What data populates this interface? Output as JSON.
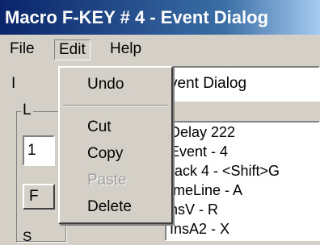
{
  "window": {
    "title": "Macro F-KEY # 4 - Event Dialog"
  },
  "menubar": {
    "file": "File",
    "edit": "Edit",
    "help": "Help"
  },
  "background": {
    "label_partial": "I",
    "name_field_value": "vent Dialog",
    "group_caption": "L",
    "small_field_value": "1",
    "small_button_label": "F",
    "bottom_partial": "S"
  },
  "event_list": [
    "Delay 222",
    "Event - 4",
    "rack 4 - <Shift>G",
    "imeLine - A",
    "nsV - R",
    "InsA2 - X"
  ],
  "edit_menu": {
    "undo": "Undo",
    "cut": "Cut",
    "copy": "Copy",
    "paste": "Paste",
    "delete": "Delete"
  }
}
